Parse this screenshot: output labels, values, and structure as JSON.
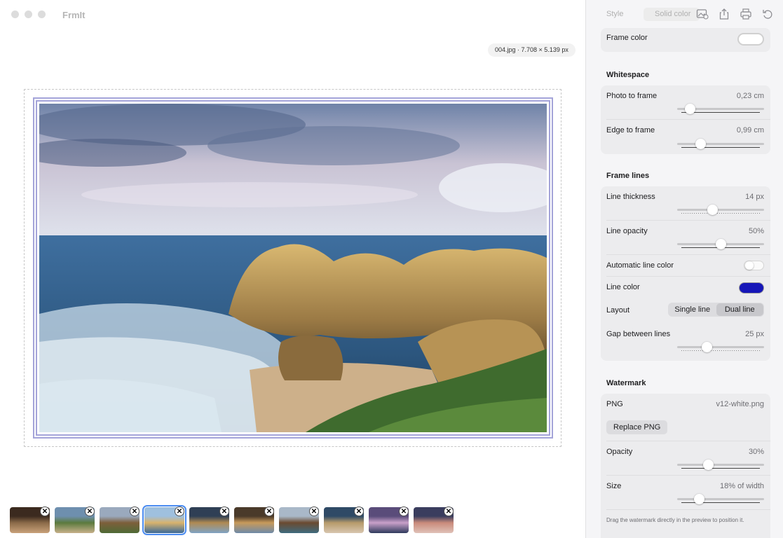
{
  "app": {
    "title": "FrmIt"
  },
  "file_info": "004.jpg · 7.708 × 5.139 px",
  "colors": {
    "frame_line": "#a4a4d9",
    "line_color": "#1616b8",
    "selection": "#4a8bf0",
    "sidebar_bg": "#f5f5f7"
  },
  "thumbnails": {
    "count": 10,
    "selected_index": 3,
    "remove_glyph": "✕"
  },
  "toolbar": {
    "style_label": "Style",
    "style_value": "Solid color",
    "icons": [
      "image-settings-icon",
      "share-icon",
      "print-icon",
      "reset-icon"
    ]
  },
  "sidebar": {
    "frame_color_label": "Frame color",
    "whitespace": {
      "title": "Whitespace",
      "photo_to_frame": {
        "label": "Photo to frame",
        "value": "0,23 cm",
        "fraction": 0.1
      },
      "edge_to_frame": {
        "label": "Edge to frame",
        "value": "0,99 cm",
        "fraction": 0.24
      }
    },
    "frame_lines": {
      "title": "Frame lines",
      "line_thickness": {
        "label": "Line thickness",
        "value": "14 px",
        "fraction": 0.39
      },
      "line_opacity": {
        "label": "Line opacity",
        "value": "50%",
        "fraction": 0.5
      },
      "automatic_line_color": {
        "label": "Automatic line color",
        "on": false
      },
      "line_color": {
        "label": "Line color"
      },
      "layout": {
        "label": "Layout",
        "options": [
          "Single line",
          "Dual line"
        ],
        "selected": "Dual line"
      },
      "gap_between_lines": {
        "label": "Gap between lines",
        "value": "25 px",
        "fraction": 0.32
      }
    },
    "watermark": {
      "title": "Watermark",
      "png": {
        "label": "PNG",
        "value": "v12-white.png"
      },
      "replace_button": "Replace PNG",
      "opacity": {
        "label": "Opacity",
        "value": "30%",
        "fraction": 0.34
      },
      "size": {
        "label": "Size",
        "value": "18% of width",
        "fraction": 0.22
      },
      "hint": "Drag the watermark directly in the preview to position it."
    }
  }
}
